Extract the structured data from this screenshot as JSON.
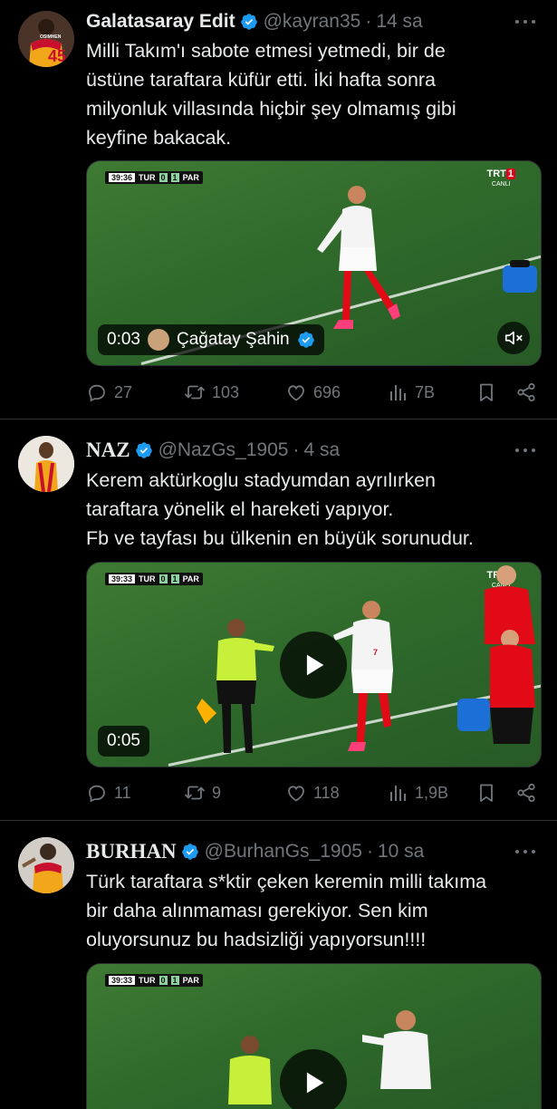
{
  "tweets": [
    {
      "name": "Galatasaray Edit",
      "handle": "@kayran35",
      "dot": "·",
      "time": "14 sa",
      "avatar_jersey_number": "45",
      "avatar_jersey_name": "OSIMHEN",
      "text_lines": [
        "Milli Takım'ı sabote etmesi yetmedi, bir de",
        "üstüne taraftara küfür etti. İki hafta sonra",
        "milyonluk villasında hiçbir şey olmamış gibi",
        "keyfine bakacak."
      ],
      "video": {
        "duration": "0:03",
        "uploader": "Çağatay Şahin",
        "clock": "39:36",
        "home": "TUR",
        "away": "PAR",
        "score_home": "0",
        "score_away": "1",
        "broadcaster": "TRT",
        "broadcaster_num": "1",
        "broadcaster_sub": "CANLI"
      },
      "replies": "27",
      "reposts": "103",
      "likes": "696",
      "views": "7B"
    },
    {
      "name": "NAZ",
      "handle": "@NazGs_1905",
      "dot": "·",
      "time": "4 sa",
      "text_lines": [
        "Kerem aktürkoglu stadyumdan ayrılırken",
        "taraftara yönelik el hareketi yapıyor.",
        "Fb ve tayfası bu ülkenin en büyük sorunudur."
      ],
      "video": {
        "duration": "0:05",
        "clock": "39:33",
        "home": "TUR",
        "away": "PAR",
        "score_home": "0",
        "score_away": "1",
        "broadcaster": "TRT",
        "broadcaster_num": "1",
        "broadcaster_sub": "CANLI",
        "player_number": "7"
      },
      "replies": "11",
      "reposts": "9",
      "likes": "118",
      "views": "1,9B"
    },
    {
      "name": "BURHAN",
      "handle": "@BurhanGs_1905",
      "dot": "·",
      "time": "10 sa",
      "text_lines": [
        "Türk taraftara s*ktir çeken keremin milli takıma",
        "bir daha alınmaması gerekiyor. Sen kim",
        "oluyorsunuz bu hadsizliği yapıyorsun!!!!"
      ],
      "video": {
        "clock": "39:33",
        "home": "TUR",
        "away": "PAR",
        "score_home": "0",
        "score_away": "1"
      }
    }
  ],
  "colors": {
    "verified": "#1d9bf0",
    "text": "#e7e9ea",
    "muted": "#71767b",
    "divider": "#2f3336",
    "turkey_red": "#e30a17"
  },
  "icons": [
    "verified-badge-icon",
    "more-icon",
    "reply-icon",
    "repost-icon",
    "like-icon",
    "views-icon",
    "bookmark-icon",
    "share-icon",
    "mute-icon",
    "play-icon"
  ]
}
